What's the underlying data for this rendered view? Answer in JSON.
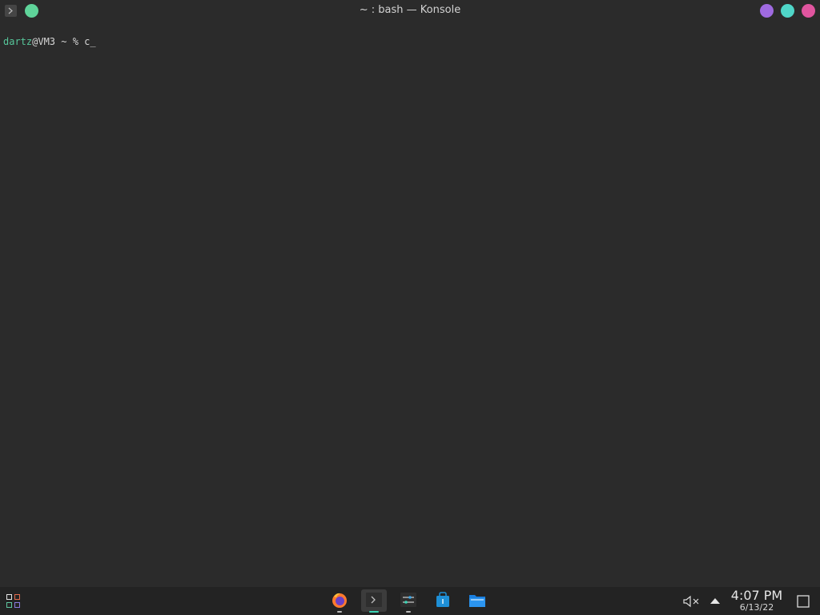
{
  "window": {
    "title": "~ : bash — Konsole",
    "app_icon": "terminal-icon",
    "left_circle_color": "#5fd49a",
    "right_circles": [
      {
        "name": "minimize-button",
        "color": "#9f6ae0"
      },
      {
        "name": "maximize-button",
        "color": "#4fd6c8"
      },
      {
        "name": "close-button",
        "color": "#e0559f"
      }
    ]
  },
  "terminal": {
    "user": "dartz",
    "host_suffix": "@VM3 ~ % ",
    "typed": "c",
    "cursor": "_",
    "prompt_user_color": "#57c79b"
  },
  "taskbar": {
    "launcher_icon": "app-grid-icon",
    "apps": [
      {
        "name": "firefox-icon",
        "label": "Firefox",
        "running": true
      },
      {
        "name": "konsole-icon",
        "label": "Konsole",
        "running": true,
        "active": true
      },
      {
        "name": "settings-icon",
        "label": "System Settings",
        "running": true
      },
      {
        "name": "store-icon",
        "label": "Discover",
        "running": false
      },
      {
        "name": "files-icon",
        "label": "Dolphin",
        "running": false
      }
    ],
    "tray": {
      "volume_icon": "volume-muted-icon",
      "expand_icon": "tray-expand-icon",
      "time": "4:07 PM",
      "date": "6/13/22",
      "desktop_icon": "show-desktop-icon"
    },
    "accent": "#3ad6b6"
  }
}
